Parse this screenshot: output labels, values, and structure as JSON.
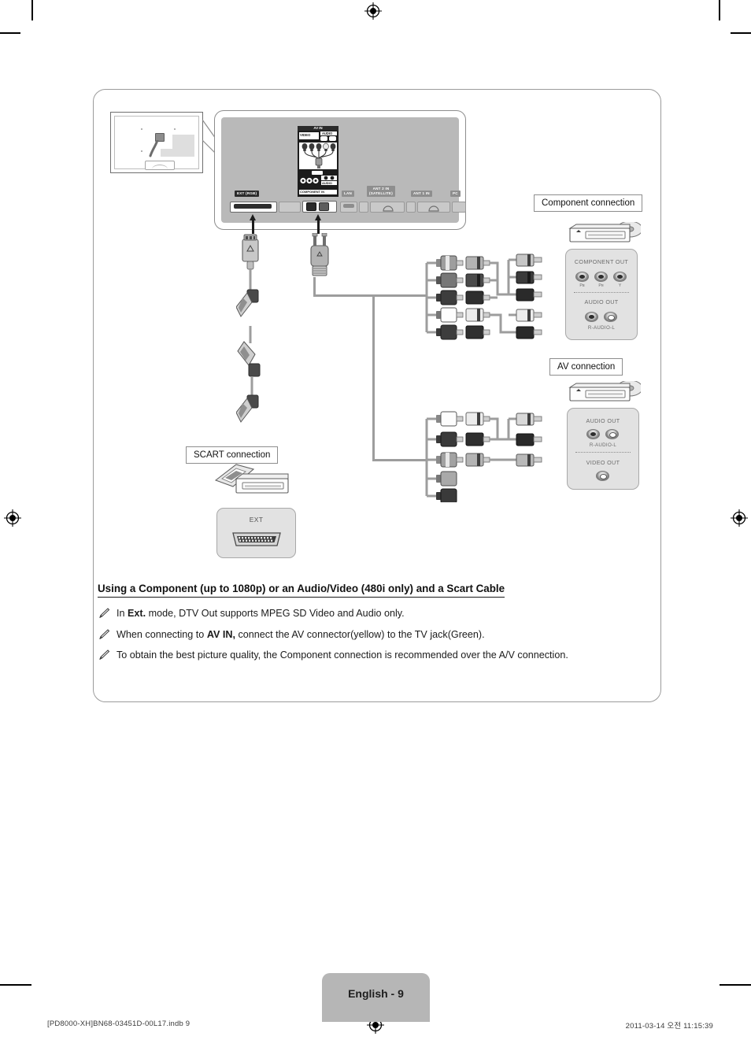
{
  "page": {
    "heading": "Using a Component (up to 1080p) or an Audio/Video (480i only) and a Scart Cable",
    "page_tab": "English - 9",
    "footer_left": "[PD8000-XH]BN68-03451D-00L17.indb   9",
    "footer_right": "2011-03-14   오전 11:15:39"
  },
  "notes": [
    {
      "prefix": "In ",
      "bold": "Ext.",
      "suffix": " mode, DTV Out supports MPEG SD Video and Audio only."
    },
    {
      "prefix": "When connecting to ",
      "bold": "AV IN,",
      "suffix": " connect the AV connector(yellow) to the TV jack(Green)."
    },
    {
      "prefix": "To obtain the best picture quality, the Component connection is recommended over the A/V connection.",
      "bold": "",
      "suffix": ""
    }
  ],
  "callouts": {
    "component": "Component connection",
    "av": "AV connection",
    "scart": "SCART connection"
  },
  "tv_panel": {
    "ports": [
      {
        "label": "EXT (RGB)",
        "style": "dark"
      },
      {
        "label": "COMPONENT IN",
        "style": "dark"
      },
      {
        "label": "LAN",
        "style": "grey"
      },
      {
        "label": "ANT 2 IN\n(SATELLITE)",
        "style": "grey"
      },
      {
        "label": "ANT 1 IN",
        "style": "grey"
      },
      {
        "label": "PC",
        "style": "grey"
      }
    ],
    "avin_diagram": {
      "title": "AV IN",
      "video": "VIDEO",
      "audio": "AUDIO",
      "audio_bottom": "AUDIO",
      "component_in": "COMPONENT IN"
    }
  },
  "component_device": {
    "panel_title": "COMPONENT OUT",
    "component_jacks": [
      "Pʙ",
      "Pʀ",
      "Y"
    ],
    "audio_title": "AUDIO OUT",
    "audio_label": "R-AUDIO-L"
  },
  "av_device": {
    "audio_title": "AUDIO OUT",
    "audio_label": "R-AUDIO-L",
    "video_title": "VIDEO OUT"
  },
  "scart_device": {
    "ext_label": "EXT"
  },
  "colors": {
    "panel_grey": "#b9b9b9",
    "jack_panel": "#e2e2e2",
    "wire": "#9d9d9d",
    "tab_grey": "#b6b6b6",
    "text": "#1a1a1a"
  }
}
